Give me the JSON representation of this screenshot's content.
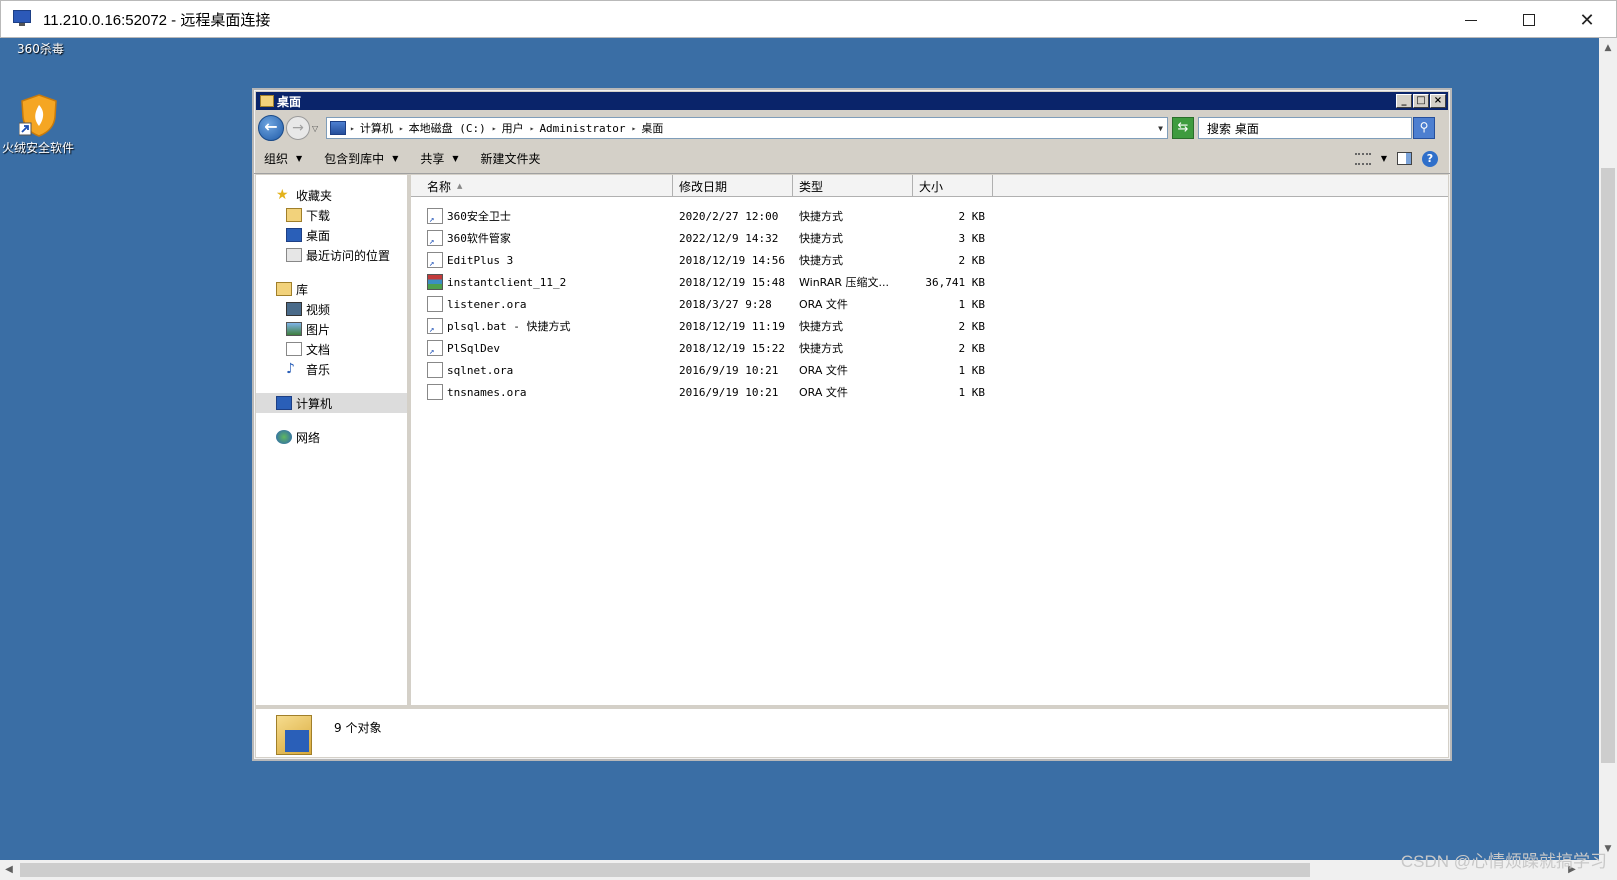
{
  "rdp": {
    "title": "11.210.0.16:52072 - 远程桌面连接",
    "controls": {
      "minimize": "—",
      "maximize": "☐",
      "close": "✕"
    }
  },
  "desktop": {
    "icons": [
      {
        "label": "360杀毒",
        "icon": "360-antivirus-icon"
      },
      {
        "label": "火绒安全软件",
        "icon": "huorong-shield-icon"
      }
    ]
  },
  "explorer": {
    "title": "桌面",
    "address": {
      "crumbs": [
        "计算机",
        "本地磁盘 (C:)",
        "用户",
        "Administrator",
        "桌面"
      ]
    },
    "search_placeholder": "搜索 桌面",
    "toolbar": {
      "organize": "组织",
      "include_in_library": "包含到库中",
      "share": "共享",
      "new_folder": "新建文件夹"
    },
    "nav": {
      "favorites": "收藏夹",
      "downloads": "下载",
      "desktop": "桌面",
      "recent": "最近访问的位置",
      "libraries": "库",
      "videos": "视频",
      "pictures": "图片",
      "documents": "文档",
      "music": "音乐",
      "computer": "计算机",
      "network": "网络"
    },
    "columns": {
      "name": "名称",
      "date": "修改日期",
      "type": "类型",
      "size": "大小"
    },
    "files": [
      {
        "name": "360安全卫士",
        "date": "2020/2/27 12:00",
        "type": "快捷方式",
        "size": "2 KB",
        "icon": "shortcut-icon"
      },
      {
        "name": "360软件管家",
        "date": "2022/12/9 14:32",
        "type": "快捷方式",
        "size": "3 KB",
        "icon": "shortcut-icon"
      },
      {
        "name": "EditPlus 3",
        "date": "2018/12/19 14:56",
        "type": "快捷方式",
        "size": "2 KB",
        "icon": "shortcut-icon"
      },
      {
        "name": "instantclient_11_2",
        "date": "2018/12/19 15:48",
        "type": "WinRAR 压缩文...",
        "size": "36,741 KB",
        "icon": "winrar-icon"
      },
      {
        "name": "listener.ora",
        "date": "2018/3/27 9:28",
        "type": "ORA 文件",
        "size": "1 KB",
        "icon": "file-icon"
      },
      {
        "name": "plsql.bat - 快捷方式",
        "date": "2018/12/19 11:19",
        "type": "快捷方式",
        "size": "2 KB",
        "icon": "shortcut-icon"
      },
      {
        "name": "PlSqlDev",
        "date": "2018/12/19 15:22",
        "type": "快捷方式",
        "size": "2 KB",
        "icon": "shortcut-icon"
      },
      {
        "name": "sqlnet.ora",
        "date": "2016/9/19 10:21",
        "type": "ORA 文件",
        "size": "1 KB",
        "icon": "file-icon"
      },
      {
        "name": "tnsnames.ora",
        "date": "2016/9/19 10:21",
        "type": "ORA 文件",
        "size": "1 KB",
        "icon": "file-icon"
      }
    ],
    "status": "9 个对象"
  },
  "watermark": "CSDN @心情烦躁就搞学习",
  "colors": {
    "desktop_bg": "#3a6ea5",
    "title_active": "#0a246a",
    "chrome": "#d4d0c8"
  }
}
